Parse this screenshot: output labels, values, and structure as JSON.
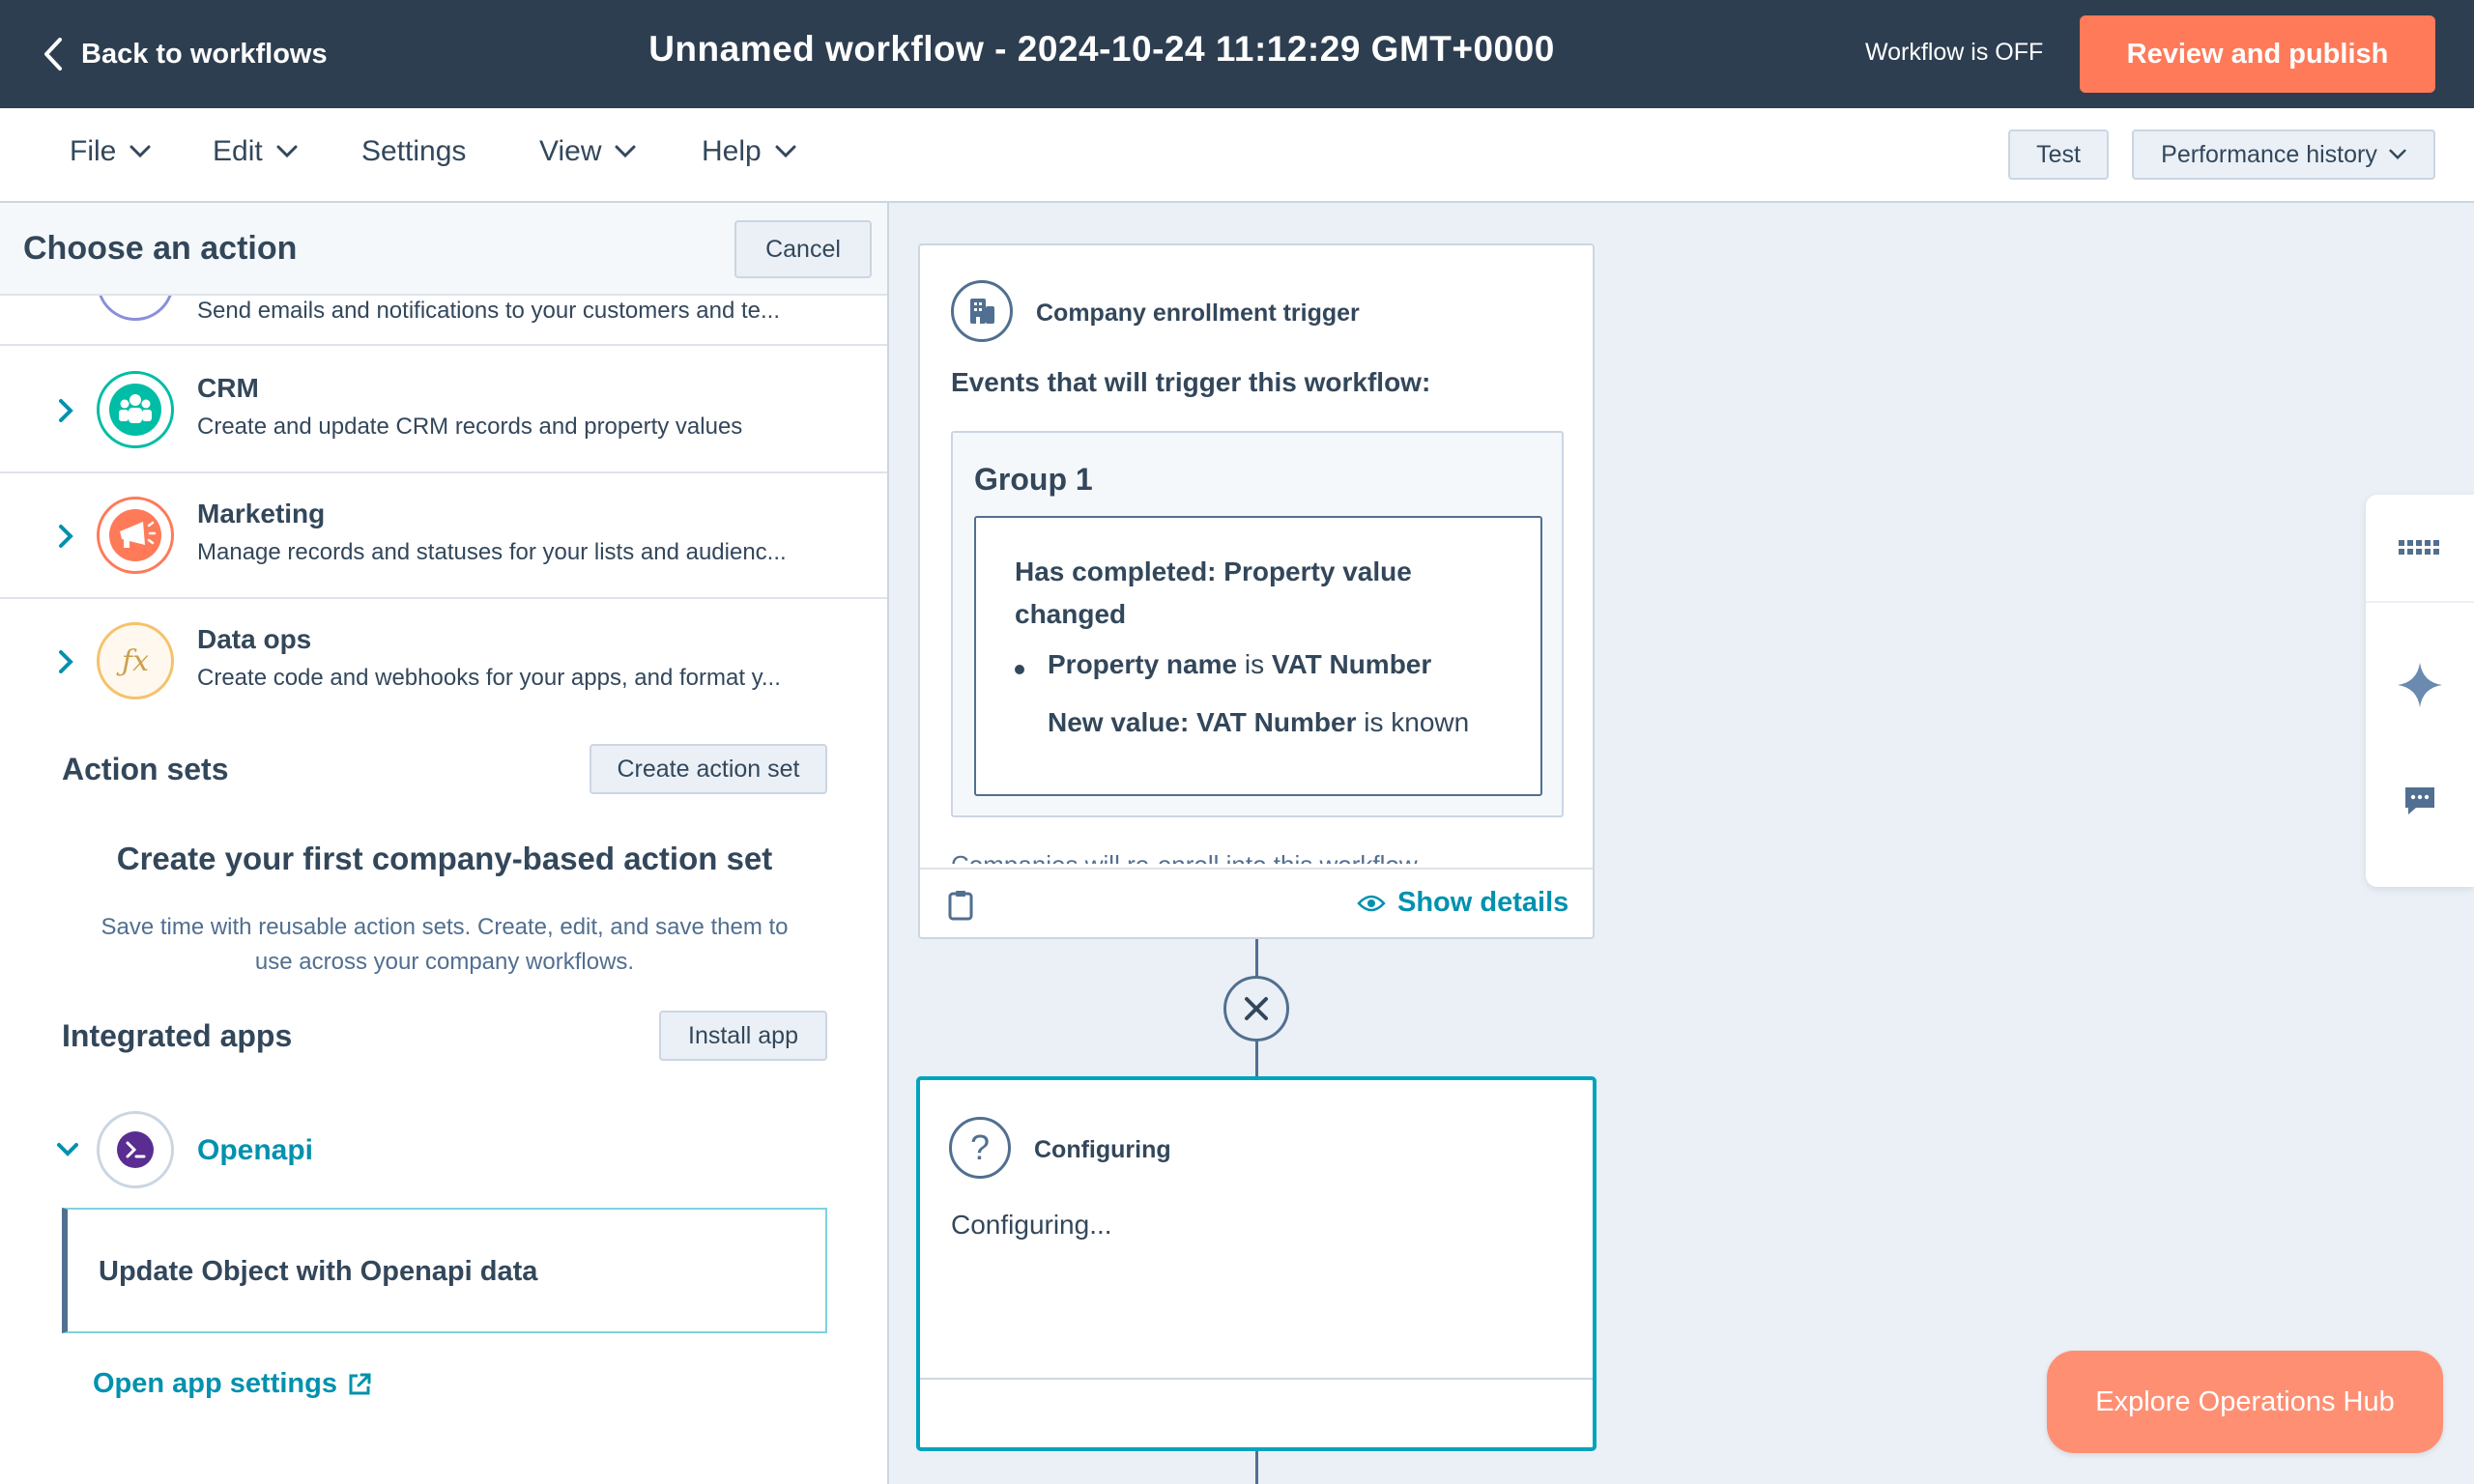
{
  "header": {
    "back_label": "Back to workflows",
    "title": "Unnamed workflow - 2024-10-24 11:12:29 GMT+0000",
    "status": "Workflow is OFF",
    "publish_label": "Review and publish"
  },
  "menu": {
    "file": "File",
    "edit": "Edit",
    "settings": "Settings",
    "view": "View",
    "help": "Help",
    "test": "Test",
    "performance": "Performance history"
  },
  "panel": {
    "title": "Choose an action",
    "cancel": "Cancel",
    "cut_desc": "Send emails and notifications to your customers and te...",
    "categories": [
      {
        "name": "CRM",
        "desc": "Create and update CRM records and property values",
        "icon": "crm-icon",
        "color": "#00bda5"
      },
      {
        "name": "Marketing",
        "desc": "Manage records and statuses for your lists and audienc...",
        "icon": "megaphone-icon",
        "color": "#ff7a59"
      },
      {
        "name": "Data ops",
        "desc": "Create code and webhooks for your apps, and format y...",
        "icon": "function-icon",
        "color": "#f5c26b"
      }
    ],
    "action_sets": {
      "title": "Action sets",
      "button": "Create action set",
      "empty_title": "Create your first company-based action set",
      "empty_desc": "Save time with reusable action sets. Create, edit, and save them to use across your company workflows."
    },
    "integrated_apps": {
      "title": "Integrated apps",
      "button": "Install app",
      "app_name": "Openapi",
      "action": "Update Object with Openapi data",
      "settings_link": "Open app settings"
    }
  },
  "trigger": {
    "label": "Company enrollment trigger",
    "events_label": "Events that will trigger this workflow:",
    "group_title": "Group 1",
    "filter_title": "Has completed: Property value changed",
    "prop_key": "Property name",
    "prop_is": " is ",
    "prop_value": "VAT Number",
    "new_value_key": "New value: VAT Number",
    "new_value_suffix": " is known",
    "cut_text": "Companies will re-enroll into this workflow",
    "show_details": "Show details"
  },
  "config": {
    "label": "Configuring",
    "text": "Configuring..."
  },
  "explore": "Explore Operations Hub",
  "colors": {
    "topbar": "#2d3e50",
    "accent": "#ff7a59",
    "link": "#0091ae",
    "selected": "#00a4bd"
  }
}
